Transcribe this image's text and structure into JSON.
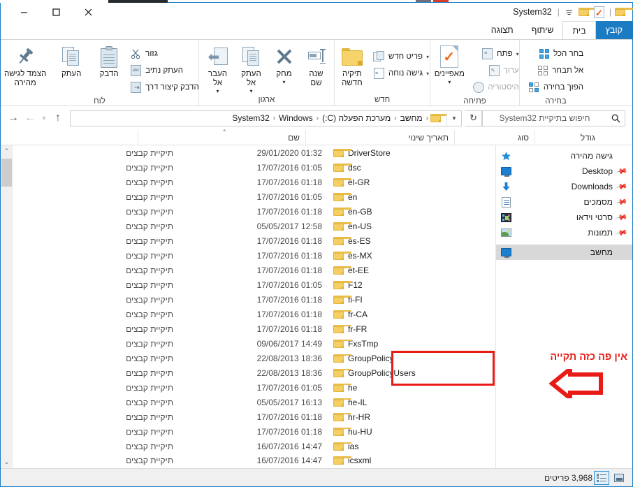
{
  "window": {
    "title": "System32",
    "controls": {
      "close": "close-icon",
      "maximize": "maximize-icon",
      "minimize": "minimize-icon"
    },
    "quick_access_toolbar": {
      "customize_label": "⇄",
      "items": [
        "folder-icon",
        "properties-icon",
        "folder-icon"
      ]
    },
    "help_label": "?",
    "collapse_ribbon_label": "⌃"
  },
  "ribbon": {
    "tabs": [
      {
        "label": "קובץ",
        "state": "file"
      },
      {
        "label": "בית",
        "state": "active"
      },
      {
        "label": "שיתוף",
        "state": "normal"
      },
      {
        "label": "תצוגה",
        "state": "normal"
      }
    ],
    "groups": [
      {
        "name": "clipboard",
        "label": "לוח",
        "big_buttons": [
          {
            "label": "הצמד לגישה\nמהירה",
            "icon": "pin-icon"
          },
          {
            "label": "העתק",
            "icon": "copy-icon"
          },
          {
            "label": "הדבק",
            "icon": "paste-icon"
          }
        ],
        "small_items": [
          {
            "label": "גזור",
            "icon": "scissors-icon",
            "dim": false
          },
          {
            "label": "העתק נתיב",
            "icon": "copy-path-icon",
            "dim": false
          },
          {
            "label": "הדבק קיצור דרך",
            "icon": "paste-shortcut-icon",
            "dim": false
          }
        ]
      },
      {
        "name": "organize",
        "label": "ארגון",
        "big_buttons": [
          {
            "label": "העבר\nאל",
            "icon": "move-to-icon",
            "caret": "▾"
          },
          {
            "label": "העתק\nאל",
            "icon": "copy-to-icon",
            "caret": "▾"
          },
          {
            "label": "מחק",
            "icon": "delete-icon",
            "caret": "▾"
          },
          {
            "label": "שנה\nשם",
            "icon": "rename-icon"
          }
        ]
      },
      {
        "name": "new",
        "label": "חדש",
        "big_buttons": [
          {
            "label": "תיקיה\nחדשה",
            "icon": "new-folder-icon"
          }
        ],
        "small_items": [
          {
            "label": "פריט חדש",
            "icon": "new-item-icon",
            "caret": "▾"
          },
          {
            "label": "גישה נוחה",
            "icon": "easy-access-icon",
            "caret": "▾"
          }
        ]
      },
      {
        "name": "open",
        "label": "פתיחה",
        "big_buttons": [
          {
            "label": "מאפיינים",
            "icon": "properties-icon",
            "caret": "▾"
          }
        ],
        "small_items": [
          {
            "label": "פתח",
            "icon": "open-icon",
            "caret": "▾",
            "dim": false
          },
          {
            "label": "ערוך",
            "icon": "edit-icon",
            "dim": true
          },
          {
            "label": "היסטוריה",
            "icon": "history-icon",
            "dim": true
          }
        ]
      },
      {
        "name": "select",
        "label": "בחירה",
        "small_items": [
          {
            "label": "בחר הכל",
            "icon": "select-all-icon"
          },
          {
            "label": "אל תבחר",
            "icon": "select-none-icon"
          },
          {
            "label": "הפוך בחירה",
            "icon": "invert-selection-icon"
          }
        ]
      }
    ]
  },
  "navbar": {
    "back_label": "←",
    "forward_label": "→",
    "recent_label": "▾",
    "up_label": "↑",
    "breadcrumb": [
      "מחשב",
      "מערכת הפעלה (C:)",
      "Windows",
      "System32"
    ],
    "breadcrumb_separator": "‹",
    "breadcrumb_dropdown": "▾",
    "refresh_label": "↻",
    "search_placeholder": "חיפוש בתיקיית System32",
    "search_value": "",
    "search_icon": "search-icon"
  },
  "columns": [
    {
      "key": "name",
      "label": "שם",
      "sorted": true,
      "sort_mark": "⌃"
    },
    {
      "key": "date",
      "label": "תאריך שינוי",
      "sorted": false
    },
    {
      "key": "type",
      "label": "סוג",
      "sorted": false
    },
    {
      "key": "size",
      "label": "גודל",
      "sorted": false
    }
  ],
  "nav_pane": {
    "items": [
      {
        "label": "גישה מהירה",
        "icon": "quick-access-star-icon",
        "pinned": false,
        "selected": false,
        "root": true
      },
      {
        "label": "Desktop",
        "icon": "desktop-monitor-icon",
        "pinned": true,
        "selected": false
      },
      {
        "label": "Downloads",
        "icon": "downloads-arrow-icon",
        "pinned": true,
        "selected": false
      },
      {
        "label": "מסמכים",
        "icon": "documents-icon",
        "pinned": true,
        "selected": false
      },
      {
        "label": "סרטי וידאו",
        "icon": "videos-icon",
        "pinned": true,
        "selected": false
      },
      {
        "label": "תמונות",
        "icon": "pictures-icon",
        "pinned": true,
        "selected": false
      },
      {
        "label": "מחשב",
        "icon": "computer-icon",
        "pinned": false,
        "selected": true,
        "root": true
      }
    ],
    "pin_glyph": "pin-icon"
  },
  "files": [
    {
      "name": "DriverStore",
      "date": "29/01/2020 01:32",
      "type": "תיקיית קבצים",
      "size": "",
      "highlighted": false
    },
    {
      "name": "dsc",
      "date": "17/07/2016 01:05",
      "type": "תיקיית קבצים",
      "size": "",
      "highlighted": false
    },
    {
      "name": "el-GR",
      "date": "17/07/2016 01:18",
      "type": "תיקיית קבצים",
      "size": "",
      "highlighted": false
    },
    {
      "name": "en",
      "date": "17/07/2016 01:05",
      "type": "תיקיית קבצים",
      "size": "",
      "highlighted": false
    },
    {
      "name": "en-GB",
      "date": "17/07/2016 01:18",
      "type": "תיקיית קבצים",
      "size": "",
      "highlighted": false
    },
    {
      "name": "en-US",
      "date": "05/05/2017 12:58",
      "type": "תיקיית קבצים",
      "size": "",
      "highlighted": false
    },
    {
      "name": "es-ES",
      "date": "17/07/2016 01:18",
      "type": "תיקיית קבצים",
      "size": "",
      "highlighted": false
    },
    {
      "name": "es-MX",
      "date": "17/07/2016 01:18",
      "type": "תיקיית קבצים",
      "size": "",
      "highlighted": false
    },
    {
      "name": "et-EE",
      "date": "17/07/2016 01:18",
      "type": "תיקיית קבצים",
      "size": "",
      "highlighted": false
    },
    {
      "name": "F12",
      "date": "17/07/2016 01:05",
      "type": "תיקיית קבצים",
      "size": "",
      "highlighted": false
    },
    {
      "name": "fi-FI",
      "date": "17/07/2016 01:18",
      "type": "תיקיית קבצים",
      "size": "",
      "highlighted": false
    },
    {
      "name": "fr-CA",
      "date": "17/07/2016 01:18",
      "type": "תיקיית קבצים",
      "size": "",
      "highlighted": false
    },
    {
      "name": "fr-FR",
      "date": "17/07/2016 01:18",
      "type": "תיקיית קבצים",
      "size": "",
      "highlighted": false
    },
    {
      "name": "FxsTmp",
      "date": "09/06/2017 14:49",
      "type": "תיקיית קבצים",
      "size": "",
      "highlighted": false
    },
    {
      "name": "GroupPolicy",
      "date": "22/08/2013 18:36",
      "type": "תיקיית קבצים",
      "size": "",
      "highlighted": true
    },
    {
      "name": "GroupPolicyUsers",
      "date": "22/08/2013 18:36",
      "type": "תיקיית קבצים",
      "size": "",
      "highlighted": true
    },
    {
      "name": "he",
      "date": "17/07/2016 01:05",
      "type": "תיקיית קבצים",
      "size": "",
      "highlighted": false
    },
    {
      "name": "he-IL",
      "date": "05/05/2017 16:13",
      "type": "תיקיית קבצים",
      "size": "",
      "highlighted": false
    },
    {
      "name": "hr-HR",
      "date": "17/07/2016 01:18",
      "type": "תיקיית קבצים",
      "size": "",
      "highlighted": false
    },
    {
      "name": "hu-HU",
      "date": "17/07/2016 01:18",
      "type": "תיקיית קבצים",
      "size": "",
      "highlighted": false
    },
    {
      "name": "ias",
      "date": "16/07/2016 14:47",
      "type": "תיקיית קבצים",
      "size": "",
      "highlighted": false
    },
    {
      "name": "icsxml",
      "date": "16/07/2016 14:47",
      "type": "תיקיית קבצים",
      "size": "",
      "highlighted": false
    }
  ],
  "annotation": {
    "text": "אין פה כזה תקייה",
    "color": "#e81b17",
    "arrow": "left-arrow"
  },
  "statusbar": {
    "item_count": "3,968 פריטים",
    "view_buttons": [
      {
        "name": "tiles-view",
        "active": false
      },
      {
        "name": "details-view",
        "active": true
      }
    ]
  },
  "colors": {
    "accent": "#1b7cc4",
    "tab_active_bg": "#ffffff",
    "annotation_red": "#e81b17",
    "folder_yellow": "#f5cf63",
    "selection_grey": "#d8d8d8"
  }
}
